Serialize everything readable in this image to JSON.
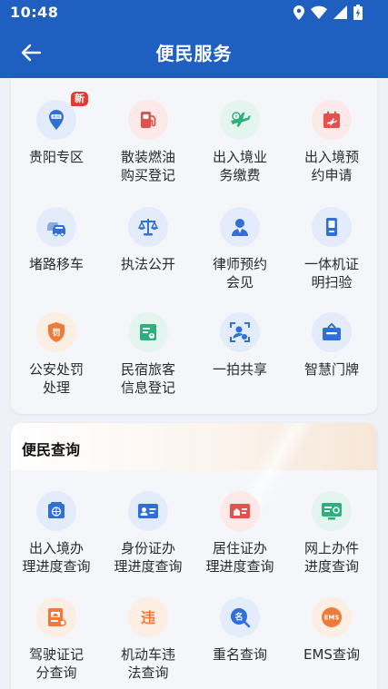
{
  "status": {
    "time": "10:48"
  },
  "nav": {
    "title": "便民服务"
  },
  "services": [
    {
      "label": "贵阳专区",
      "icon": "map-pin-icon",
      "badge": "新"
    },
    {
      "label": "散装燃油\n购买登记",
      "icon": "fuel-pump-icon"
    },
    {
      "label": "出入境业\n务缴费",
      "icon": "plane-payment-icon"
    },
    {
      "label": "出入境预\n约申请",
      "icon": "calendar-plane-icon"
    },
    {
      "label": "堵路移车",
      "icon": "car-icon"
    },
    {
      "label": "执法公开",
      "icon": "scales-icon"
    },
    {
      "label": "律师预约\n会见",
      "icon": "lawyer-icon"
    },
    {
      "label": "一体机证\n明扫验",
      "icon": "scan-machine-icon"
    },
    {
      "label": "公安处罚\n处理",
      "icon": "penalty-icon"
    },
    {
      "label": "民宿旅客\n信息登记",
      "icon": "guest-register-icon"
    },
    {
      "label": "一拍共享",
      "icon": "photo-share-icon"
    },
    {
      "label": "智慧门牌",
      "icon": "doorplate-icon"
    }
  ],
  "query": {
    "title": "便民查询",
    "items": [
      {
        "label": "出入境办\n理进度查询",
        "icon": "globe-passport-icon"
      },
      {
        "label": "身份证办\n理进度查询",
        "icon": "id-card-icon"
      },
      {
        "label": "居住证办\n理进度查询",
        "icon": "residence-card-icon"
      },
      {
        "label": "网上办件\n进度查询",
        "icon": "online-progress-icon"
      },
      {
        "label": "驾驶证记\n分查询",
        "icon": "license-points-icon"
      },
      {
        "label": "机动车违\n法查询",
        "icon": "vehicle-violation-icon"
      },
      {
        "label": "重名查询",
        "icon": "name-search-icon"
      },
      {
        "label": "EMS查询",
        "icon": "ems-icon"
      }
    ]
  },
  "colors": {
    "primary": "#1f5fbf",
    "blue_icon": "#2f6fd8",
    "red_icon": "#e2514b",
    "green_icon": "#2fae7e",
    "orange_icon": "#f07a3a"
  }
}
